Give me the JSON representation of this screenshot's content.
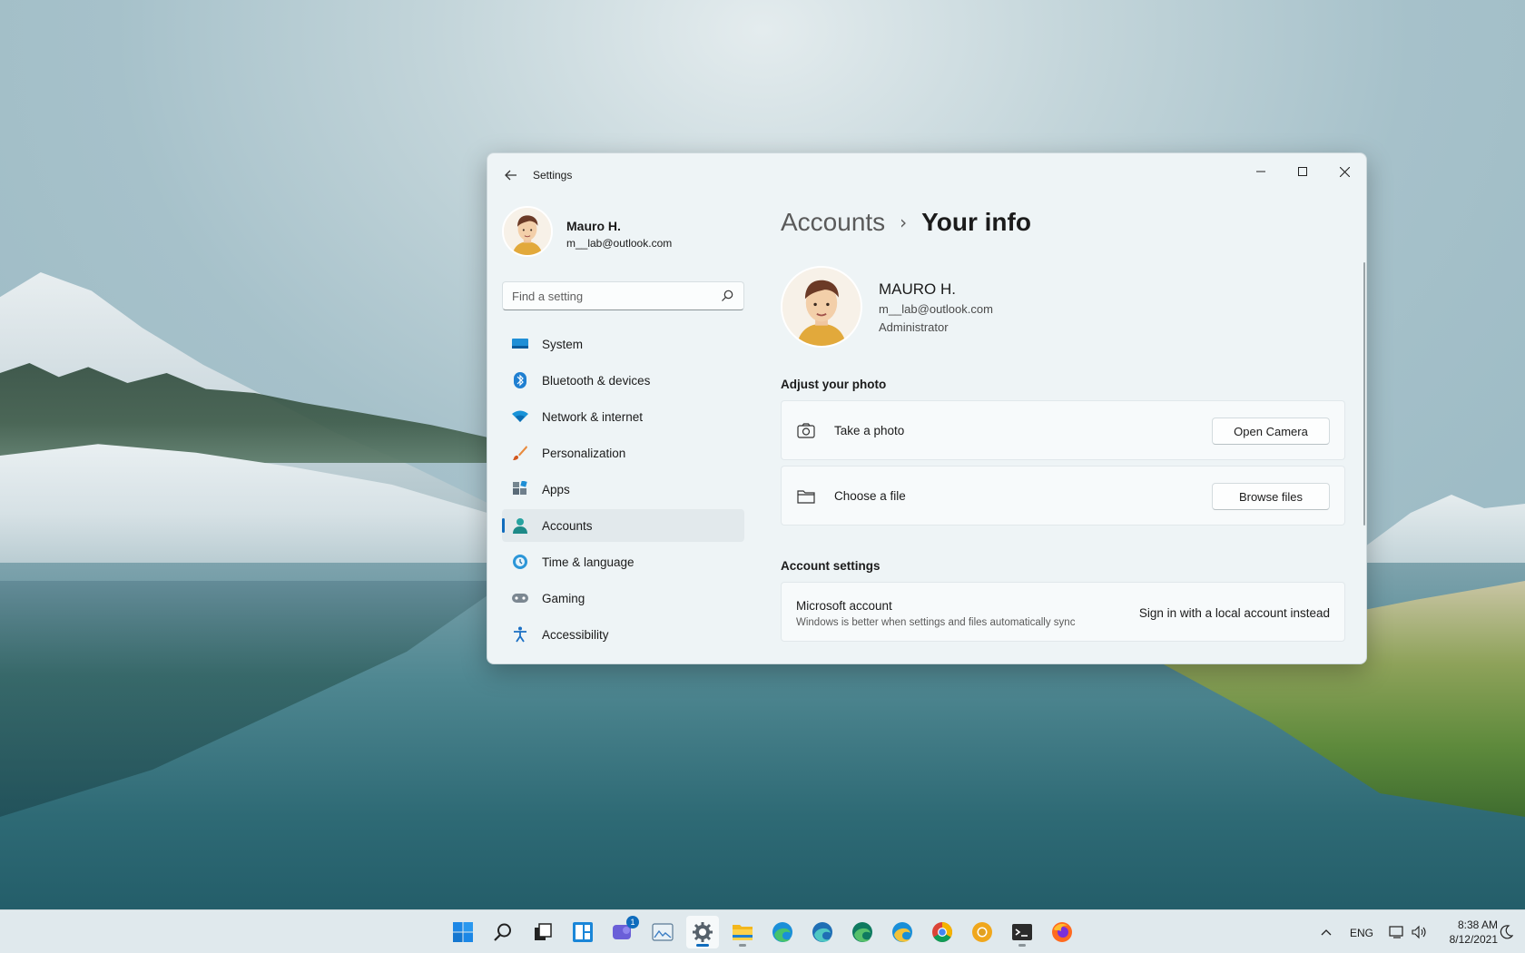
{
  "window": {
    "title": "Settings"
  },
  "profile": {
    "name": "Mauro H.",
    "email": "m__lab@outlook.com"
  },
  "search": {
    "placeholder": "Find a setting"
  },
  "sidebar": {
    "items": [
      {
        "label": "System",
        "icon": "system-icon"
      },
      {
        "label": "Bluetooth & devices",
        "icon": "bluetooth-icon"
      },
      {
        "label": "Network & internet",
        "icon": "wifi-icon"
      },
      {
        "label": "Personalization",
        "icon": "brush-icon"
      },
      {
        "label": "Apps",
        "icon": "apps-icon"
      },
      {
        "label": "Accounts",
        "icon": "person-icon",
        "active": true
      },
      {
        "label": "Time & language",
        "icon": "globe-clock-icon"
      },
      {
        "label": "Gaming",
        "icon": "controller-icon"
      },
      {
        "label": "Accessibility",
        "icon": "accessibility-icon"
      }
    ]
  },
  "breadcrumb": {
    "parent": "Accounts",
    "separator": "›",
    "current": "Your info"
  },
  "user": {
    "name": "MAURO H.",
    "email": "m__lab@outlook.com",
    "role": "Administrator"
  },
  "adjust_photo": {
    "title": "Adjust your photo",
    "take_photo": {
      "label": "Take a photo",
      "button": "Open Camera"
    },
    "choose_file": {
      "label": "Choose a file",
      "button": "Browse files"
    }
  },
  "account_settings": {
    "title": "Account settings",
    "ms_account": {
      "title": "Microsoft account",
      "subtitle": "Windows is better when settings and files automatically sync",
      "link": "Sign in with a local account instead"
    }
  },
  "taskbar": {
    "chat_badge": "1",
    "language": "ENG",
    "time": "8:38 AM",
    "date": "8/12/2021"
  },
  "colors": {
    "accent": "#0f6cbd",
    "window_bg": "#eef4f6"
  }
}
